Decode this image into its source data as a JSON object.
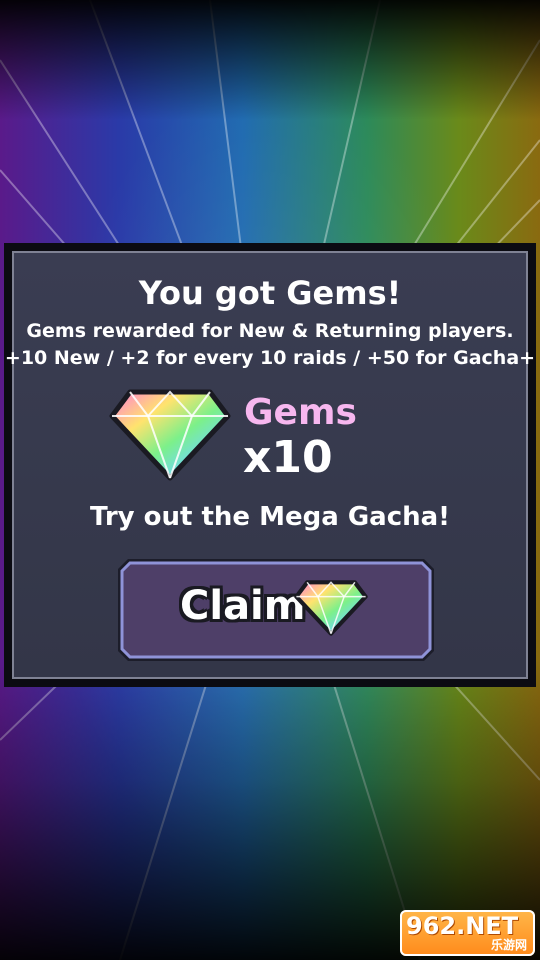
{
  "dialog": {
    "title": "You got Gems!",
    "subtitle_line1": "Gems rewarded for New & Returning players.",
    "subtitle_line2": "+10 New / +2 for every 10 raids / +50 for Gacha+",
    "reward_label": "Gems",
    "reward_count": "x10",
    "prompt": "Try out the Mega Gacha!",
    "claim_label": "Claim"
  },
  "watermark": {
    "text": "962.NET",
    "subtext": "乐游网"
  },
  "icons": [
    "gem-icon",
    "gem-icon"
  ],
  "colors": {
    "reward_label": "#f7b7ef",
    "button_fill": "#4e3f68",
    "button_border": "#8f93d8"
  }
}
